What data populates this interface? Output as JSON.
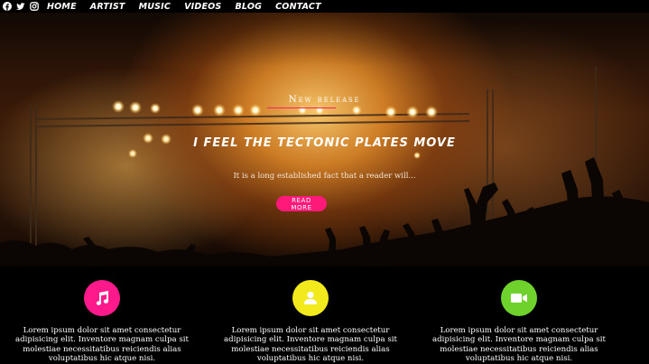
{
  "nav": {
    "social": [
      {
        "icon": "facebook-icon"
      },
      {
        "icon": "twitter-icon"
      },
      {
        "icon": "instagram-icon"
      }
    ],
    "links": [
      "HOME",
      "ARTIST",
      "MUSIC",
      "VIDEOS",
      "BLOG",
      "CONTACT"
    ]
  },
  "hero": {
    "kicker": "New release",
    "title": "I FEEL THE TECTONIC PLATES MOVE",
    "subtitle": "It is a long established fact that a reader will...",
    "button": "READ MORE"
  },
  "features": [
    {
      "icon": "music-note-icon",
      "color": "#ff1a8c",
      "text": "Lorem ipsum dolor sit amet consectetur adipisicing elit. Inventore magnam culpa sit molestiae necessitatibus reiciendis alias voluptatibus hic atque nisi."
    },
    {
      "icon": "user-icon",
      "color": "#f2ea1c",
      "text": "Lorem ipsum dolor sit amet consectetur adipisicing elit. Inventore magnam culpa sit molestiae necessitatibus reiciendis alias voluptatibus hic atque nisi."
    },
    {
      "icon": "video-camera-icon",
      "color": "#6fd12b",
      "text": "Lorem ipsum dolor sit amet consectetur adipisicing elit. Inventore magnam culpa sit molestiae necessitatibus reiciendis alias voluptatibus hic atque nisi."
    }
  ]
}
